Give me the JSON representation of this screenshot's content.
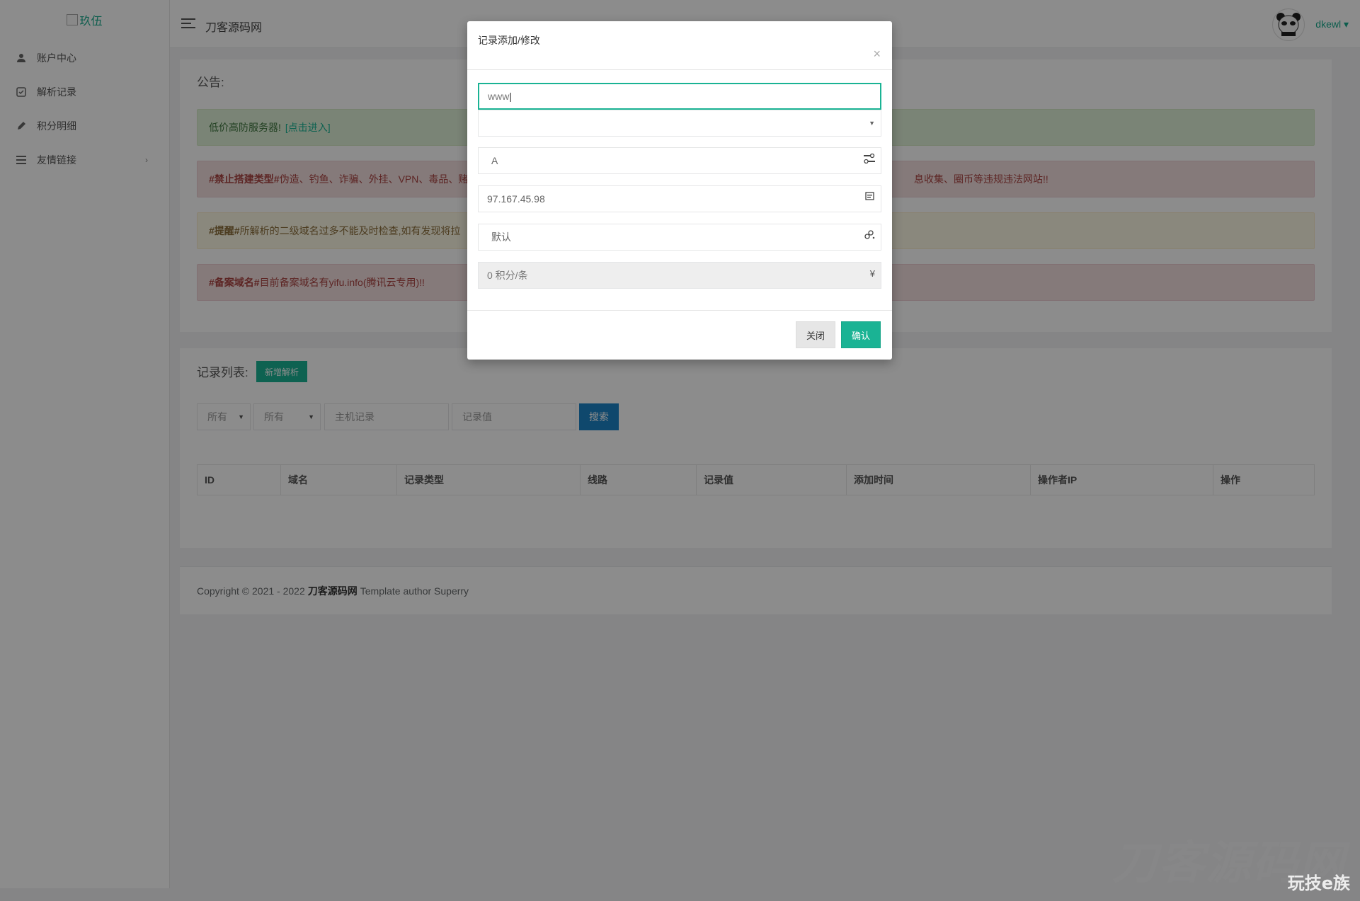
{
  "sidebar": {
    "logo_alt": "玖伍",
    "items": [
      {
        "label": "账户中心",
        "icon": "user-icon"
      },
      {
        "label": "解析记录",
        "icon": "record-icon"
      },
      {
        "label": "积分明细",
        "icon": "pencil-icon"
      },
      {
        "label": "友情链接",
        "icon": "list-icon",
        "arrow": "›"
      }
    ]
  },
  "topbar": {
    "site_name": "刀客源码网",
    "user_name": "dkewl",
    "user_caret": "▾"
  },
  "notice": {
    "title": "公告:",
    "green_text": "低价高防服务器!",
    "green_link": "[点击进入]",
    "red1_tag": "#禁止搭建类型#",
    "red1_text": " 伪造、钓鱼、诈骗、外挂、VPN、毒品、赌",
    "red1_tail": "息收集、圈币等违规违法网站!!",
    "yellow_tag": "#提醒#",
    "yellow_text": " 所解析的二级域名过多不能及时检查,如有发现将拉",
    "red2_tag": "#备案域名#",
    "red2_text": " 目前备案域名有yifu.info(腾讯云专用)!!"
  },
  "records": {
    "title": "记录列表:",
    "new_button": "新增解析",
    "filter_type": "所有",
    "filter_line": "所有",
    "host_placeholder": "主机记录",
    "value_placeholder": "记录值",
    "search_button": "搜索",
    "columns": [
      "ID",
      "域名",
      "记录类型",
      "线路",
      "记录值",
      "添加时间",
      "操作者IP",
      "操作"
    ]
  },
  "footer": {
    "prefix": "Copyright © 2021 - 2022",
    "brand": "刀客源码网",
    "suffix": "Template author Superry"
  },
  "modal": {
    "title": "记录添加/修改",
    "close_symbol": "×",
    "host_value": "www",
    "domain_value": "",
    "type_value": "A",
    "record_value": "97.167.45.98",
    "line_value": "默认",
    "cost_value": "0 积分/条",
    "cost_symbol": "¥",
    "close_button": "关闭",
    "confirm_button": "确认"
  },
  "watermarks": {
    "large": "刀客源码网",
    "small": "玩技e族"
  },
  "colors": {
    "accent": "#1ab394",
    "primary_blue": "#1c84c6",
    "alert_green": "#dff0d8",
    "alert_red": "#f2dede",
    "alert_yellow": "#fcf8e3"
  }
}
